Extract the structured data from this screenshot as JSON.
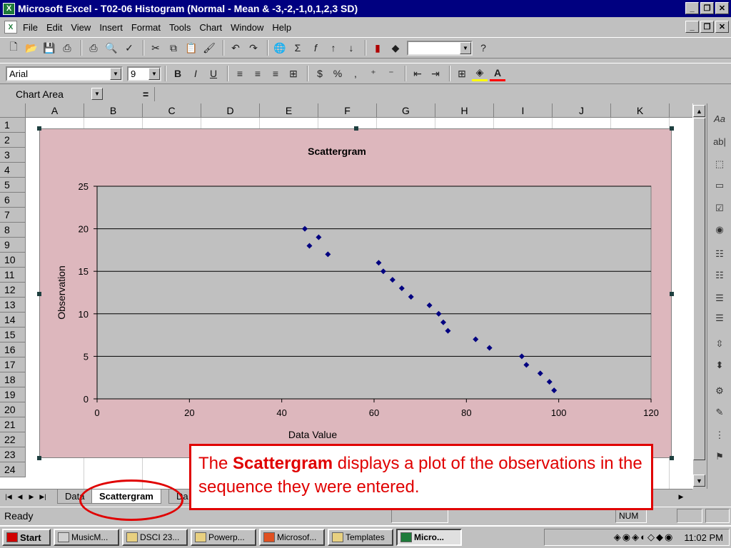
{
  "window": {
    "title": "Microsoft Excel - T02-06 Histogram (Normal - Mean & -3,-2,-1,0,1,2,3 SD)"
  },
  "menu": [
    "File",
    "Edit",
    "View",
    "Insert",
    "Format",
    "Tools",
    "Chart",
    "Window",
    "Help"
  ],
  "toolbar": {
    "font": "Arial",
    "size": "9"
  },
  "formula_bar": {
    "name_box": "Chart Area",
    "equals": "="
  },
  "columns": [
    "A",
    "B",
    "C",
    "D",
    "E",
    "F",
    "G",
    "H",
    "I",
    "J",
    "K"
  ],
  "rows": [
    "1",
    "2",
    "3",
    "4",
    "5",
    "6",
    "7",
    "8",
    "9",
    "10",
    "11",
    "12",
    "13",
    "14",
    "15",
    "16",
    "17",
    "18",
    "19",
    "20",
    "21",
    "22",
    "23",
    "24"
  ],
  "sheet_tabs": [
    "Data",
    "Scattergram",
    "Da"
  ],
  "status": {
    "text": "Ready",
    "num": "NUM"
  },
  "taskbar": {
    "start": "Start",
    "items": [
      "MusicM...",
      "DSCI 23...",
      "Powerp...",
      "Microsof...",
      "Templates",
      "Micro..."
    ],
    "clock": "11:02 PM"
  },
  "callout": {
    "prefix": "The ",
    "bold": "Scattergram",
    "suffix": " displays a plot of the observations in the sequence they were entered."
  },
  "colors": {
    "chart_area": "#ddb7bd",
    "plot_area": "#c0c0c0",
    "marker": "#000080",
    "callout_red": "#e00000"
  },
  "chart_data": {
    "type": "scatter",
    "title": "Scattergram",
    "xlabel": "Data Value",
    "ylabel": "Observation",
    "xlim": [
      0,
      120
    ],
    "ylim": [
      0,
      25
    ],
    "xticks": [
      0,
      20,
      40,
      60,
      80,
      100,
      120
    ],
    "yticks": [
      0,
      5,
      10,
      15,
      20,
      25
    ],
    "grid": "horizontal",
    "points": [
      {
        "x": 45,
        "y": 20
      },
      {
        "x": 46,
        "y": 18
      },
      {
        "x": 48,
        "y": 19
      },
      {
        "x": 50,
        "y": 17
      },
      {
        "x": 61,
        "y": 16
      },
      {
        "x": 62,
        "y": 15
      },
      {
        "x": 64,
        "y": 14
      },
      {
        "x": 66,
        "y": 13
      },
      {
        "x": 68,
        "y": 12
      },
      {
        "x": 72,
        "y": 11
      },
      {
        "x": 74,
        "y": 10
      },
      {
        "x": 75,
        "y": 9
      },
      {
        "x": 76,
        "y": 8
      },
      {
        "x": 82,
        "y": 7
      },
      {
        "x": 85,
        "y": 6
      },
      {
        "x": 92,
        "y": 5
      },
      {
        "x": 93,
        "y": 4
      },
      {
        "x": 96,
        "y": 3
      },
      {
        "x": 98,
        "y": 2
      },
      {
        "x": 99,
        "y": 1
      }
    ]
  }
}
